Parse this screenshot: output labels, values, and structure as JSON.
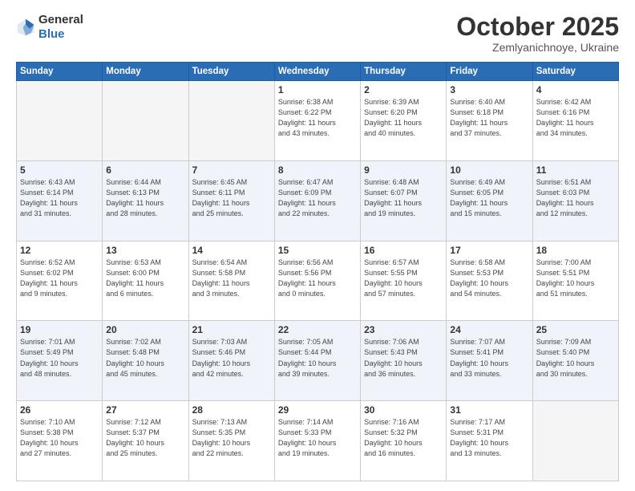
{
  "header": {
    "logo_general": "General",
    "logo_blue": "Blue",
    "month": "October 2025",
    "location": "Zemlyanichnoye, Ukraine"
  },
  "weekdays": [
    "Sunday",
    "Monday",
    "Tuesday",
    "Wednesday",
    "Thursday",
    "Friday",
    "Saturday"
  ],
  "weeks": [
    [
      {
        "day": "",
        "info": ""
      },
      {
        "day": "",
        "info": ""
      },
      {
        "day": "",
        "info": ""
      },
      {
        "day": "1",
        "info": "Sunrise: 6:38 AM\nSunset: 6:22 PM\nDaylight: 11 hours\nand 43 minutes."
      },
      {
        "day": "2",
        "info": "Sunrise: 6:39 AM\nSunset: 6:20 PM\nDaylight: 11 hours\nand 40 minutes."
      },
      {
        "day": "3",
        "info": "Sunrise: 6:40 AM\nSunset: 6:18 PM\nDaylight: 11 hours\nand 37 minutes."
      },
      {
        "day": "4",
        "info": "Sunrise: 6:42 AM\nSunset: 6:16 PM\nDaylight: 11 hours\nand 34 minutes."
      }
    ],
    [
      {
        "day": "5",
        "info": "Sunrise: 6:43 AM\nSunset: 6:14 PM\nDaylight: 11 hours\nand 31 minutes."
      },
      {
        "day": "6",
        "info": "Sunrise: 6:44 AM\nSunset: 6:13 PM\nDaylight: 11 hours\nand 28 minutes."
      },
      {
        "day": "7",
        "info": "Sunrise: 6:45 AM\nSunset: 6:11 PM\nDaylight: 11 hours\nand 25 minutes."
      },
      {
        "day": "8",
        "info": "Sunrise: 6:47 AM\nSunset: 6:09 PM\nDaylight: 11 hours\nand 22 minutes."
      },
      {
        "day": "9",
        "info": "Sunrise: 6:48 AM\nSunset: 6:07 PM\nDaylight: 11 hours\nand 19 minutes."
      },
      {
        "day": "10",
        "info": "Sunrise: 6:49 AM\nSunset: 6:05 PM\nDaylight: 11 hours\nand 15 minutes."
      },
      {
        "day": "11",
        "info": "Sunrise: 6:51 AM\nSunset: 6:03 PM\nDaylight: 11 hours\nand 12 minutes."
      }
    ],
    [
      {
        "day": "12",
        "info": "Sunrise: 6:52 AM\nSunset: 6:02 PM\nDaylight: 11 hours\nand 9 minutes."
      },
      {
        "day": "13",
        "info": "Sunrise: 6:53 AM\nSunset: 6:00 PM\nDaylight: 11 hours\nand 6 minutes."
      },
      {
        "day": "14",
        "info": "Sunrise: 6:54 AM\nSunset: 5:58 PM\nDaylight: 11 hours\nand 3 minutes."
      },
      {
        "day": "15",
        "info": "Sunrise: 6:56 AM\nSunset: 5:56 PM\nDaylight: 11 hours\nand 0 minutes."
      },
      {
        "day": "16",
        "info": "Sunrise: 6:57 AM\nSunset: 5:55 PM\nDaylight: 10 hours\nand 57 minutes."
      },
      {
        "day": "17",
        "info": "Sunrise: 6:58 AM\nSunset: 5:53 PM\nDaylight: 10 hours\nand 54 minutes."
      },
      {
        "day": "18",
        "info": "Sunrise: 7:00 AM\nSunset: 5:51 PM\nDaylight: 10 hours\nand 51 minutes."
      }
    ],
    [
      {
        "day": "19",
        "info": "Sunrise: 7:01 AM\nSunset: 5:49 PM\nDaylight: 10 hours\nand 48 minutes."
      },
      {
        "day": "20",
        "info": "Sunrise: 7:02 AM\nSunset: 5:48 PM\nDaylight: 10 hours\nand 45 minutes."
      },
      {
        "day": "21",
        "info": "Sunrise: 7:03 AM\nSunset: 5:46 PM\nDaylight: 10 hours\nand 42 minutes."
      },
      {
        "day": "22",
        "info": "Sunrise: 7:05 AM\nSunset: 5:44 PM\nDaylight: 10 hours\nand 39 minutes."
      },
      {
        "day": "23",
        "info": "Sunrise: 7:06 AM\nSunset: 5:43 PM\nDaylight: 10 hours\nand 36 minutes."
      },
      {
        "day": "24",
        "info": "Sunrise: 7:07 AM\nSunset: 5:41 PM\nDaylight: 10 hours\nand 33 minutes."
      },
      {
        "day": "25",
        "info": "Sunrise: 7:09 AM\nSunset: 5:40 PM\nDaylight: 10 hours\nand 30 minutes."
      }
    ],
    [
      {
        "day": "26",
        "info": "Sunrise: 7:10 AM\nSunset: 5:38 PM\nDaylight: 10 hours\nand 27 minutes."
      },
      {
        "day": "27",
        "info": "Sunrise: 7:12 AM\nSunset: 5:37 PM\nDaylight: 10 hours\nand 25 minutes."
      },
      {
        "day": "28",
        "info": "Sunrise: 7:13 AM\nSunset: 5:35 PM\nDaylight: 10 hours\nand 22 minutes."
      },
      {
        "day": "29",
        "info": "Sunrise: 7:14 AM\nSunset: 5:33 PM\nDaylight: 10 hours\nand 19 minutes."
      },
      {
        "day": "30",
        "info": "Sunrise: 7:16 AM\nSunset: 5:32 PM\nDaylight: 10 hours\nand 16 minutes."
      },
      {
        "day": "31",
        "info": "Sunrise: 7:17 AM\nSunset: 5:31 PM\nDaylight: 10 hours\nand 13 minutes."
      },
      {
        "day": "",
        "info": ""
      }
    ]
  ],
  "alt_rows": [
    1,
    3
  ]
}
